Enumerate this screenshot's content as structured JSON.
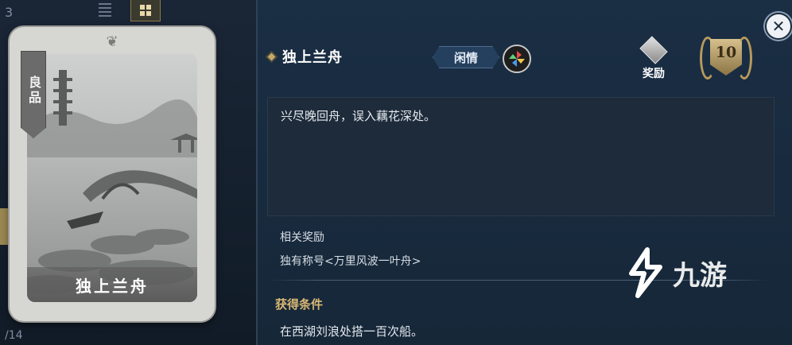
{
  "background": {
    "top_number": "3",
    "bottom_number": "/14"
  },
  "card": {
    "rarity": "良品",
    "name": "独上兰舟"
  },
  "detail": {
    "title": "独上兰舟",
    "category": "闲情",
    "category_icon": "pinwheel-icon",
    "reward_button_label": "奖励",
    "level": "10",
    "close_icon": "close-icon",
    "description": "兴尽晚回舟，误入藕花深处。",
    "related_rewards_title": "相关奖励",
    "related_rewards_value": "独有称号<万里风波一叶舟>",
    "condition_title": "获得条件",
    "condition_value": "在西湖刘浪处搭一百次船。"
  },
  "watermark": {
    "text": "九游"
  },
  "colors": {
    "panel_bg": "#1a2e44",
    "accent_gold": "#d9b874",
    "badge_blue": "#25405e"
  }
}
